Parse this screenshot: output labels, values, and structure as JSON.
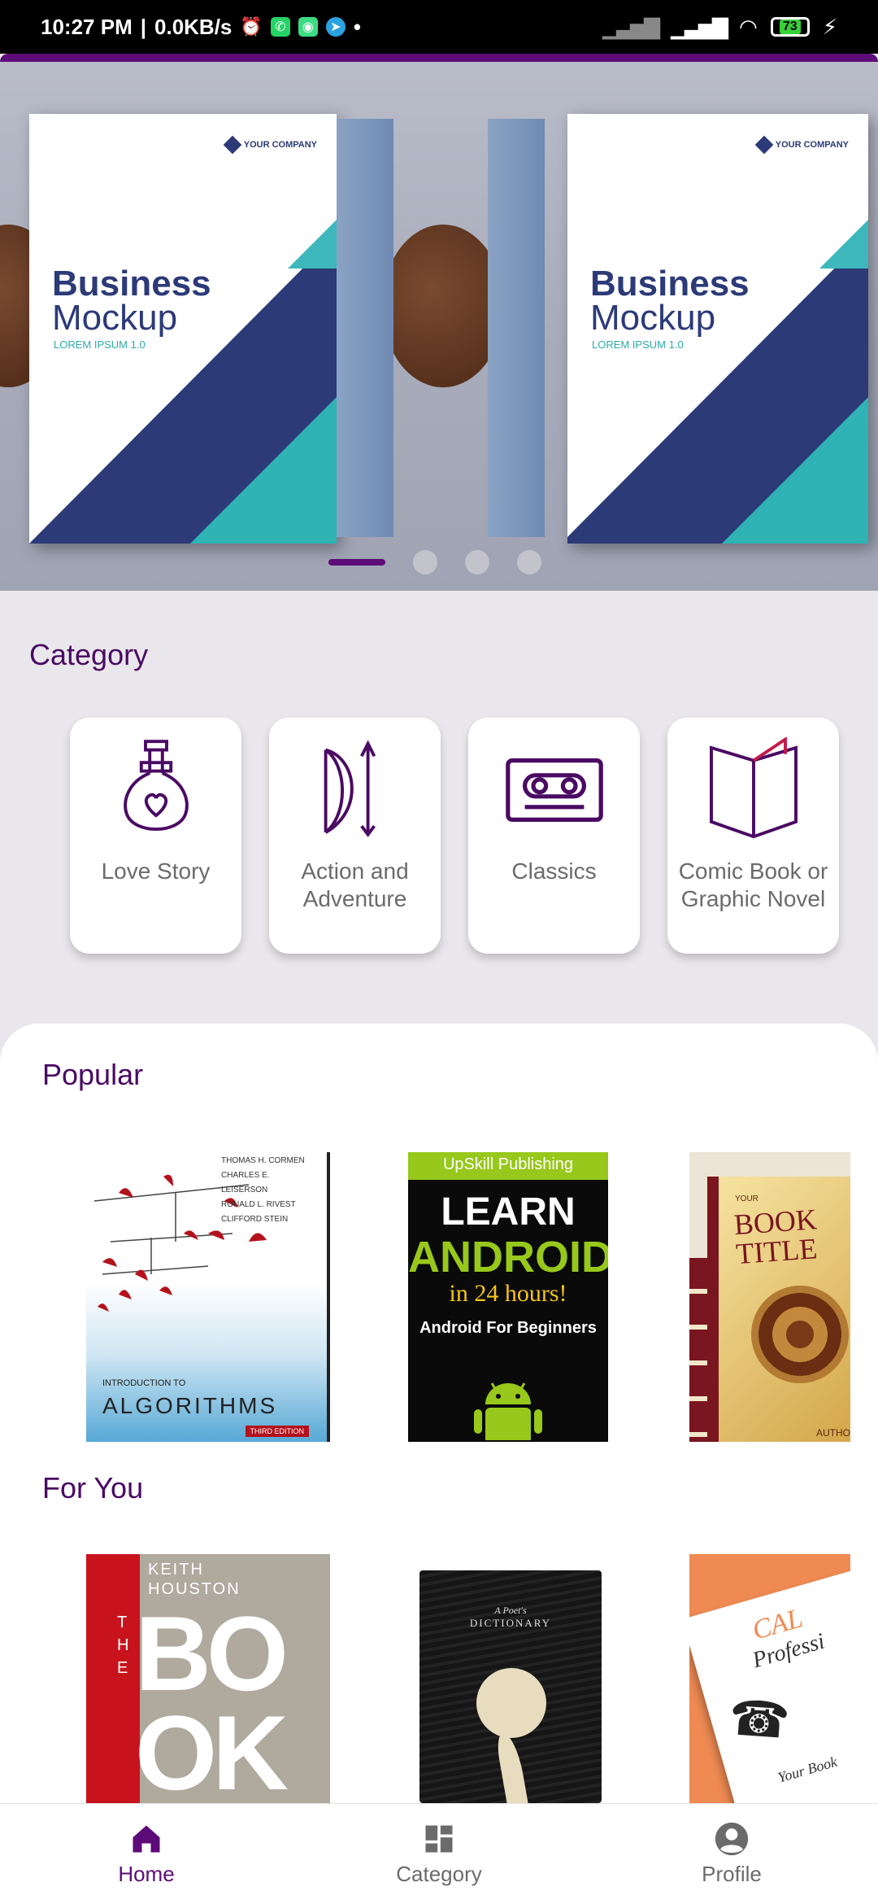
{
  "status_bar": {
    "time": "10:27 PM",
    "separator": "|",
    "speed": "0.0KB/s",
    "battery": "73"
  },
  "banner": {
    "books": [
      {
        "brand": "YOUR COMPANY",
        "title_line1": "Business",
        "title_line2": "Mockup",
        "subtitle": "LOREM IPSUM 1.0"
      },
      {
        "brand": "YOUR COMPANY",
        "title_line1": "Business",
        "title_line2": "Mockup",
        "subtitle": "LOREM IPSUM 1.0"
      }
    ],
    "slides": 4,
    "active_slide": 1
  },
  "category": {
    "title": "Category",
    "items": [
      {
        "label": "Love Story",
        "icon": "potion-heart-icon"
      },
      {
        "label": "Action and Adventure",
        "icon": "bow-arrow-icon"
      },
      {
        "label": "Classics",
        "icon": "cassette-icon"
      },
      {
        "label": "Comic Book or Graphic Novel",
        "icon": "open-book-icon"
      }
    ]
  },
  "popular": {
    "title": "Popular",
    "books": [
      {
        "authors": [
          "THOMAS H. CORMEN",
          "CHARLES E. LEISERSON",
          "RONALD L. RIVEST",
          "CLIFFORD STEIN"
        ],
        "intro": "INTRODUCTION TO",
        "title": "ALGORITHMS",
        "edition": "THIRD EDITION"
      },
      {
        "publisher": "UpSkill Publishing",
        "line1": "LEARN",
        "line2": "ANDROID",
        "line3": "in 24 hours!",
        "line4": "Android For Beginners"
      },
      {
        "small": "YOUR",
        "title": "BOOK TITLE",
        "author": "AUTHO"
      }
    ]
  },
  "for_you": {
    "title": "For You",
    "books": [
      {
        "author_line1": "KEITH",
        "author_line2": "HOUSTON",
        "the": "THE",
        "big1": "BO",
        "big2": "OK"
      },
      {
        "top1": "A Poet's",
        "top2": "DICTIONARY"
      },
      {
        "script1": "CAL",
        "script2": "Professi",
        "foot": "Your Book"
      }
    ]
  },
  "bottom_nav": {
    "items": [
      {
        "label": "Home",
        "icon": "home-icon",
        "active": true
      },
      {
        "label": "Category",
        "icon": "dashboard-icon",
        "active": false
      },
      {
        "label": "Profile",
        "icon": "profile-icon",
        "active": false
      }
    ]
  },
  "colors": {
    "accent": "#5d0b78",
    "background": "#e9e7eb"
  }
}
